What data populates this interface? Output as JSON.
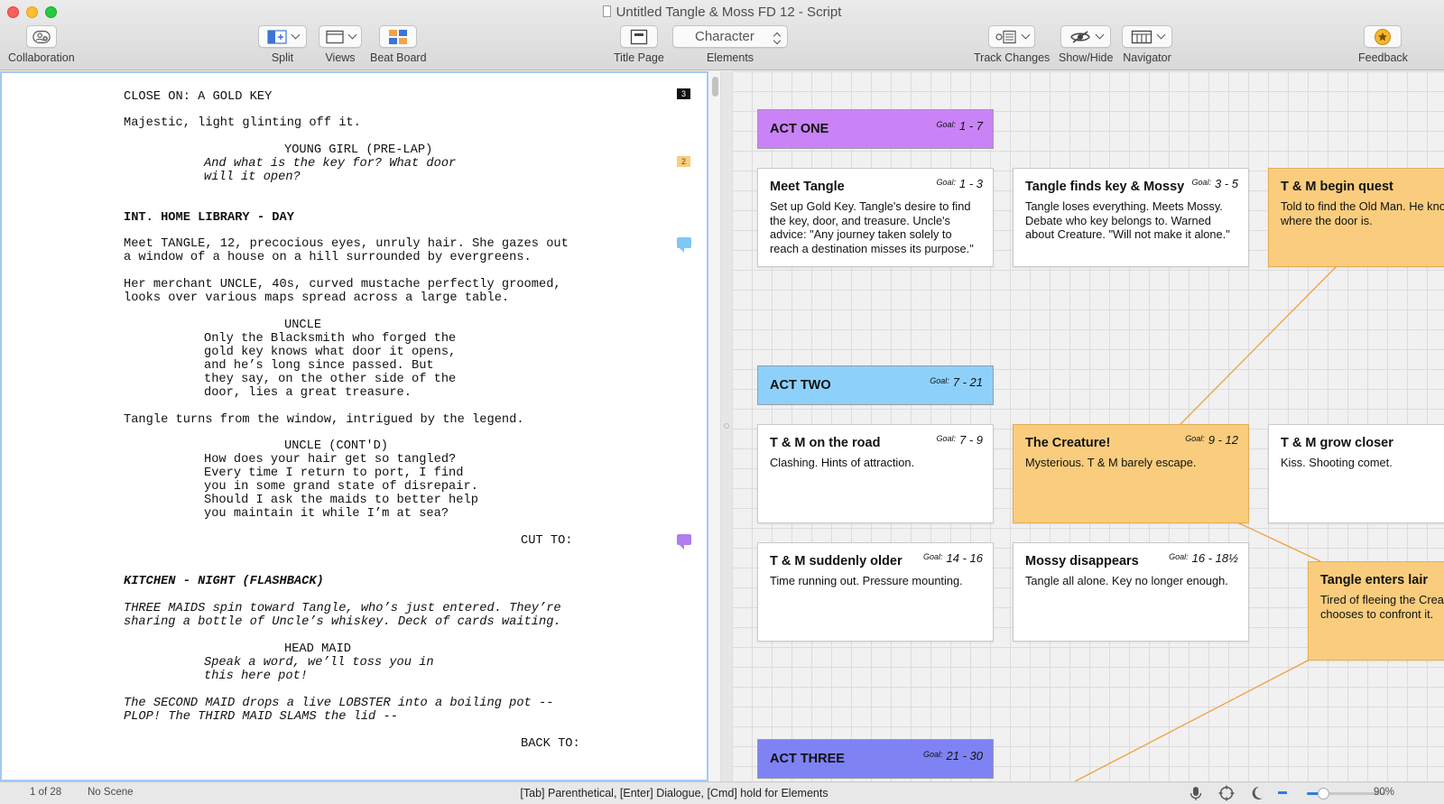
{
  "window": {
    "title": "Untitled Tangle & Moss FD 12 - Script"
  },
  "toolbar": {
    "collaboration": "Collaboration",
    "split": "Split",
    "views": "Views",
    "beat_board": "Beat Board",
    "title_page": "Title Page",
    "elements_label": "Elements",
    "elements_value": "Character",
    "track_changes": "Track Changes",
    "show_hide": "Show/Hide",
    "navigator": "Navigator",
    "feedback": "Feedback"
  },
  "script": {
    "lines": [
      {
        "text": "CLOSE ON: A GOLD KEY",
        "indent": 0,
        "style": ""
      },
      {
        "text": "Majestic, light glinting off it.",
        "indent": 0,
        "style": ""
      },
      {
        "text": "YOUNG GIRL (PRE-LAP)",
        "indent": 2,
        "style": ""
      },
      {
        "text": "And what is the key for? What door",
        "indent": 1,
        "style": "italic"
      },
      {
        "text": "will it open?",
        "indent": 1,
        "style": "italic"
      },
      {
        "text": "INT. HOME LIBRARY - DAY",
        "indent": 0,
        "style": "scene"
      },
      {
        "text": "Meet TANGLE, 12, precocious eyes, unruly hair. She gazes out",
        "indent": 0,
        "style": ""
      },
      {
        "text": "a window of a house on a hill surrounded by evergreens.",
        "indent": 0,
        "style": ""
      },
      {
        "text": "Her merchant UNCLE, 40s, curved mustache perfectly groomed,",
        "indent": 0,
        "style": ""
      },
      {
        "text": "looks over various maps spread across a large table.",
        "indent": 0,
        "style": ""
      },
      {
        "text": "UNCLE",
        "indent": 2,
        "style": ""
      },
      {
        "text": "Only the Blacksmith who forged the",
        "indent": 1,
        "style": ""
      },
      {
        "text": "gold key knows what door it opens,",
        "indent": 1,
        "style": ""
      },
      {
        "text": "and he’s long since passed. But",
        "indent": 1,
        "style": ""
      },
      {
        "text": "they say, on the other side of the",
        "indent": 1,
        "style": ""
      },
      {
        "text": "door, lies a great treasure.",
        "indent": 1,
        "style": ""
      },
      {
        "text": "Tangle turns from the window, intrigued by the legend.",
        "indent": 0,
        "style": ""
      },
      {
        "text": "UNCLE (CONT'D)",
        "indent": 2,
        "style": ""
      },
      {
        "text": "How does your hair get so tangled?",
        "indent": 1,
        "style": ""
      },
      {
        "text": "Every time I return to port, I find",
        "indent": 1,
        "style": ""
      },
      {
        "text": "you in some grand state of disrepair.",
        "indent": 1,
        "style": ""
      },
      {
        "text": "Should I ask the maids to better help",
        "indent": 1,
        "style": ""
      },
      {
        "text": "you maintain it while I’m at sea?",
        "indent": 1,
        "style": ""
      },
      {
        "text": "CUT TO:",
        "indent": 3,
        "style": ""
      },
      {
        "text": "KITCHEN - NIGHT (FLASHBACK)",
        "indent": 0,
        "style": "scene italic"
      },
      {
        "text": "THREE MAIDS spin toward Tangle, who’s just entered. They’re",
        "indent": 0,
        "style": "italic"
      },
      {
        "text": "sharing a bottle of Uncle’s whiskey. Deck of cards waiting.",
        "indent": 0,
        "style": "italic"
      },
      {
        "text": "HEAD MAID",
        "indent": 2,
        "style": ""
      },
      {
        "text": "Speak a word, we’ll toss you in",
        "indent": 1,
        "style": "italic"
      },
      {
        "text": "this here pot!",
        "indent": 1,
        "style": "italic"
      },
      {
        "text": "The SECOND MAID drops a live LOBSTER into a boiling pot --",
        "indent": 0,
        "style": "italic"
      },
      {
        "text": "PLOP! The THIRD MAID SLAMS the lid --",
        "indent": 0,
        "style": "italic"
      },
      {
        "text": "BACK TO:",
        "indent": 3,
        "style": ""
      }
    ],
    "markers": [
      {
        "type": "number",
        "text": "3",
        "color": "#111111"
      },
      {
        "type": "number",
        "text": "2",
        "color": "#f8cf7e"
      },
      {
        "type": "note",
        "color": "#7ec8f5"
      },
      {
        "type": "note",
        "color": "#b07ef0"
      }
    ]
  },
  "beat_board": {
    "goal_label": "Goal:",
    "acts": [
      {
        "title": "ACT ONE",
        "goal": "1 - 7",
        "color": "#c983f6"
      },
      {
        "title": "ACT TWO",
        "goal": "7 - 21",
        "color": "#8dd0fa"
      },
      {
        "title": "ACT THREE",
        "goal": "21 - 30",
        "color": "#7f82f3"
      }
    ],
    "cards": [
      {
        "title": "Meet Tangle",
        "goal": "1 - 3",
        "body": "Set up Gold Key. Tangle's desire to find the key, door, and treasure. Uncle's advice: \"Any journey taken solely to reach a destination misses its purpose.\"",
        "color": "white"
      },
      {
        "title": "Tangle finds key & Mossy",
        "goal": "3 - 5",
        "body": "Tangle loses everything. Meets Mossy. Debate who key belongs to. Warned about Creature. \"Will not make it alone.\"",
        "color": "white"
      },
      {
        "title": "T & M begin quest",
        "goal": "",
        "body": "Told to find the Old Man. He knows where the door is.",
        "color": "yellow"
      },
      {
        "title": "T & M on the road",
        "goal": "7 - 9",
        "body": "Clashing. Hints of attraction.",
        "color": "white"
      },
      {
        "title": "The Creature!",
        "goal": "9 - 12",
        "body": "Mysterious. T & M barely escape.",
        "color": "yellow"
      },
      {
        "title": "T & M grow closer",
        "goal": "",
        "body": "Kiss. Shooting comet.",
        "color": "white"
      },
      {
        "title": "T & M suddenly older",
        "goal": "14 - 16",
        "body": "Time running out. Pressure mounting.",
        "color": "white"
      },
      {
        "title": "Mossy disappears",
        "goal": "16 - 18½",
        "body": "Tangle all alone. Key no longer enough.",
        "color": "white"
      },
      {
        "title": "Tangle enters lair",
        "goal": "",
        "body": "Tired of fleeing the Creature, she chooses to confront it.",
        "color": "yellow"
      }
    ]
  },
  "status": {
    "page": "1 of 28",
    "scene": "No Scene",
    "hint": "[Tab]  Parenthetical,  [Enter] Dialogue, [Cmd] hold for Elements",
    "zoom": "90%",
    "zoom_level": 0.2
  }
}
